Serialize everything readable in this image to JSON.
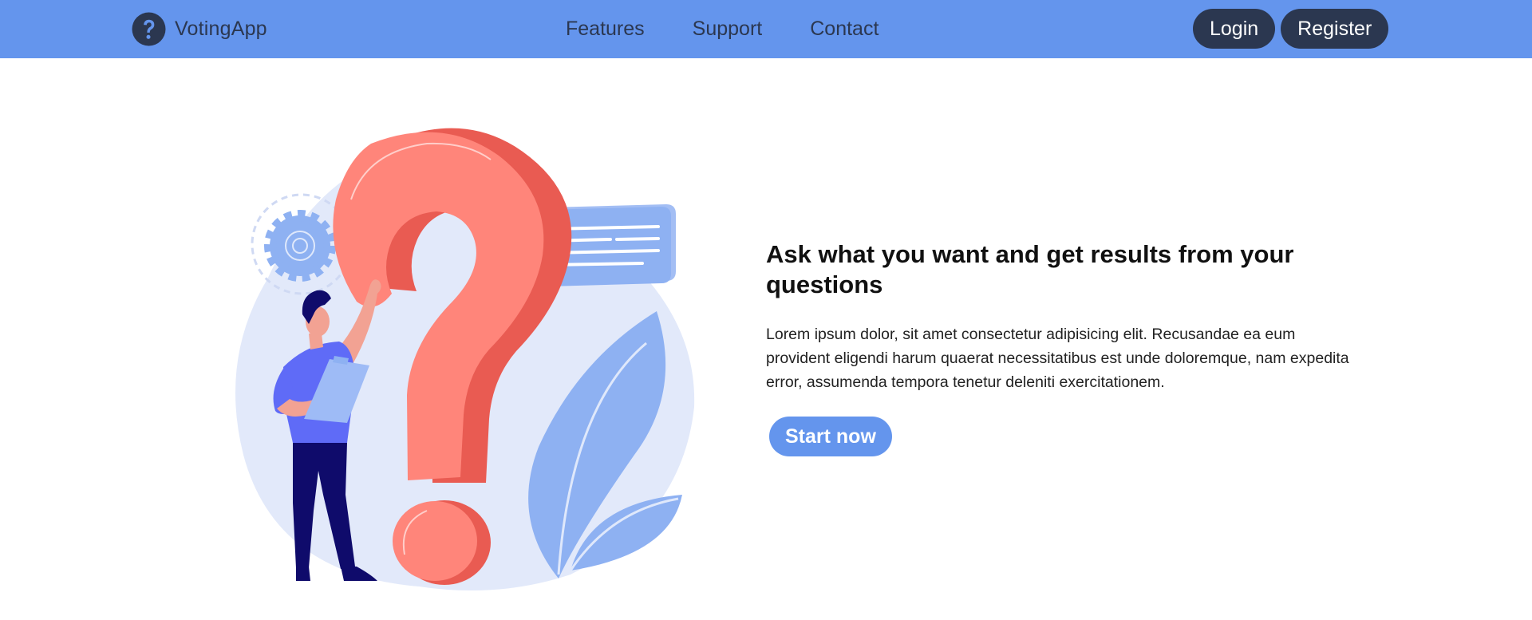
{
  "nav": {
    "brand": "VotingApp",
    "brand_icon": "question-circle-icon",
    "links": [
      "Features",
      "Support",
      "Contact"
    ],
    "login_label": "Login",
    "register_label": "Register"
  },
  "hero": {
    "title": "Ask what you want and get results from your questions",
    "body": "Lorem ipsum dolor, sit amet consectetur adipisicing elit. Recusandae ea eum provident eligendi harum quaerat necessitatibus est unde doloremque, nam expedita error, assumenda tempora tenetur deleniti exercitationem.",
    "cta_label": "Start now"
  },
  "colors": {
    "navbar": "#6495ED",
    "dark": "#2b3750",
    "accent": "#6495ED",
    "question_mark": "#FF857A"
  }
}
